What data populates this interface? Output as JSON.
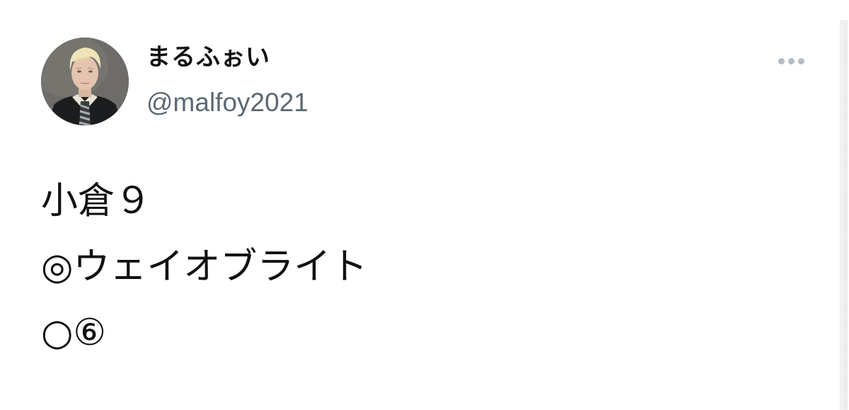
{
  "user": {
    "display_name": "まるふぉい",
    "handle": "@malfoy2021",
    "avatar_icon": "profile-photo-avatar"
  },
  "actions": {
    "more_icon": "more-horizontal-icon"
  },
  "tweet": {
    "lines": [
      "小倉９",
      "◎ウェイオブライト",
      "○⑥"
    ]
  },
  "colors": {
    "text": "#111111",
    "handle": "#5b6874",
    "more_dots": "#b3bcc4",
    "background": "#ffffff"
  }
}
